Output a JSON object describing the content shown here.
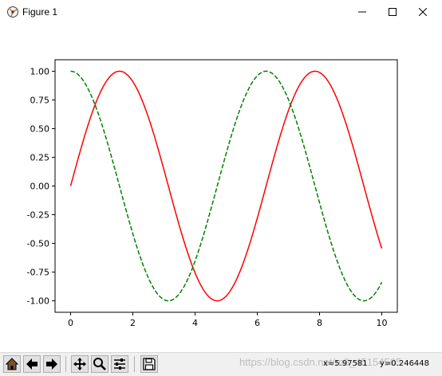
{
  "window": {
    "title": "Figure 1",
    "buttons": [
      "minimize-icon",
      "maximize-icon",
      "close-icon"
    ]
  },
  "toolbar": {
    "buttons": [
      {
        "name": "home-button",
        "icon": "home-icon"
      },
      {
        "name": "back-button",
        "icon": "arrow-left-icon"
      },
      {
        "name": "forward-button",
        "icon": "arrow-right-icon"
      },
      {
        "name": "pan-button",
        "icon": "move-icon"
      },
      {
        "name": "zoom-button",
        "icon": "magnifier-icon"
      },
      {
        "name": "configure-subplots-button",
        "icon": "sliders-icon"
      },
      {
        "name": "save-button",
        "icon": "floppy-icon"
      }
    ],
    "coord_x": "x=5.97581",
    "coord_y": "y=0.246448",
    "watermark": "https://blog.csdn.net/m0_45154565"
  },
  "chart_data": {
    "type": "line",
    "title": "",
    "xlabel": "",
    "ylabel": "",
    "xlim": [
      -0.5,
      10.5
    ],
    "ylim": [
      -1.1,
      1.1
    ],
    "xticks": [
      "0",
      "2",
      "4",
      "6",
      "8",
      "10"
    ],
    "yticks": [
      "-1.00",
      "-0.75",
      "-0.50",
      "-0.25",
      "0.00",
      "0.25",
      "0.50",
      "0.75",
      "1.00"
    ],
    "grid": false,
    "x_range": [
      0,
      10
    ],
    "series": [
      {
        "function": "sin(x)",
        "color": "#ff0000",
        "style": "solid"
      },
      {
        "function": "cos(x)",
        "color": "#008000",
        "style": "dashed"
      }
    ]
  }
}
